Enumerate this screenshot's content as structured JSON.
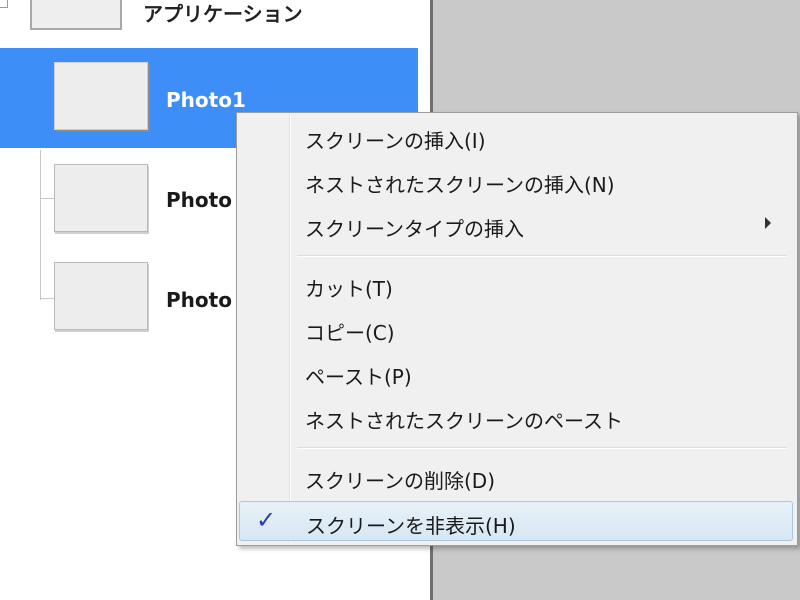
{
  "tree": {
    "root": {
      "label": "アプリケーション"
    },
    "items": [
      {
        "label": "Photo1",
        "selected": true
      },
      {
        "label": "Photo",
        "selected": false
      },
      {
        "label": "Photo",
        "selected": false
      }
    ]
  },
  "context_menu": {
    "items": [
      {
        "label": "スクリーンの挿入(I)"
      },
      {
        "label": "ネストされたスクリーンの挿入(N)"
      },
      {
        "label": "スクリーンタイプの挿入",
        "has_submenu": true
      },
      {
        "label": "カット(T)"
      },
      {
        "label": "コピー(C)"
      },
      {
        "label": "ペースト(P)"
      },
      {
        "label": "ネストされたスクリーンのペースト"
      },
      {
        "label": "スクリーンの削除(D)"
      },
      {
        "label": "スクリーンを非表示(H)",
        "checked": true,
        "highlighted": true
      }
    ],
    "check_glyph": "✓"
  },
  "colors": {
    "selection": "#3e8ef7",
    "check": "#2b3cb5",
    "canvas_bg": "#c9c9c9"
  }
}
